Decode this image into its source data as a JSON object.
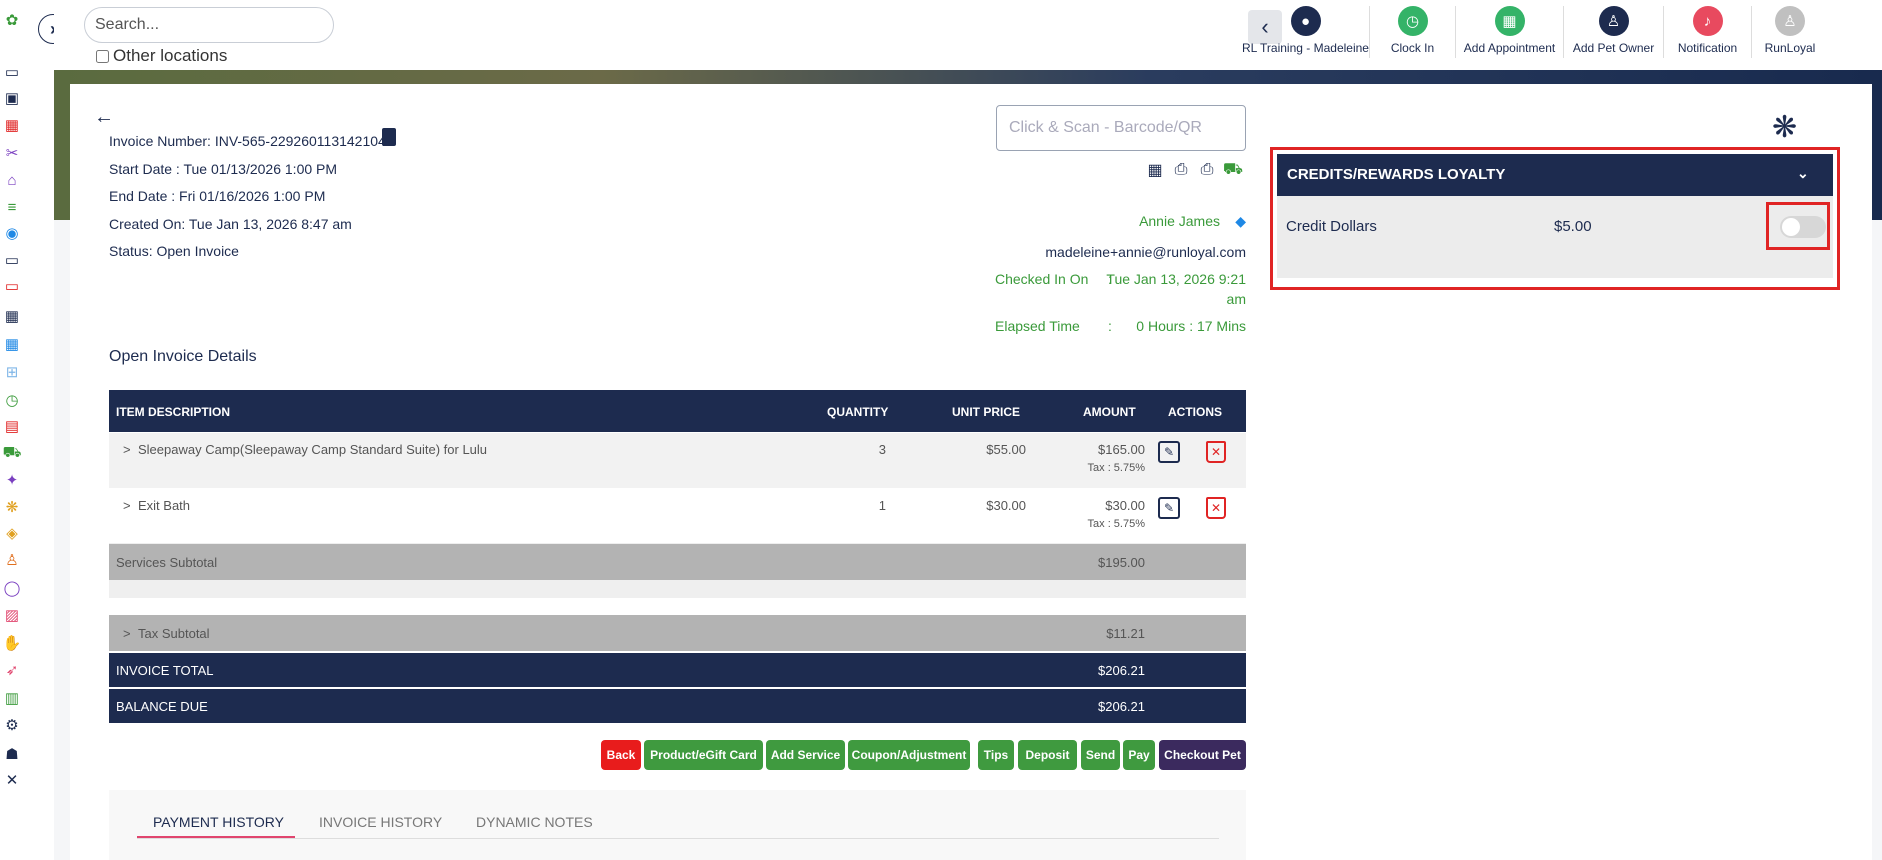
{
  "sidebar": {
    "icons": [
      {
        "name": "runloyal-logo-icon",
        "glyph": "✿",
        "color": "#3a9a3a"
      },
      {
        "name": "today-icon",
        "glyph": "▭",
        "color": "#1d2b4f"
      },
      {
        "name": "dashboard-icon",
        "glyph": "▣",
        "color": "#1d2b4f"
      },
      {
        "name": "calendar-icon",
        "glyph": "▦",
        "color": "#e02424"
      },
      {
        "name": "grooming-icon",
        "glyph": "✂",
        "color": "#7a3fc0"
      },
      {
        "name": "store-icon",
        "glyph": "⌂",
        "color": "#7a3fc0"
      },
      {
        "name": "lodging-icon",
        "glyph": "≡",
        "color": "#3a9a3a"
      },
      {
        "name": "run-card-icon",
        "glyph": "◉",
        "color": "#1e88e5"
      },
      {
        "name": "today-alt-icon",
        "glyph": "▭",
        "color": "#1d2b4f"
      },
      {
        "name": "today-red-icon",
        "glyph": "▭",
        "color": "#e02424"
      },
      {
        "name": "calendar-grid-icon",
        "glyph": "▦",
        "color": "#1d2b4f"
      },
      {
        "name": "schedule-icon",
        "glyph": "▦",
        "color": "#1e88e5"
      },
      {
        "name": "layout-icon",
        "glyph": "⊞",
        "color": "#80b7e8"
      },
      {
        "name": "timer-icon",
        "glyph": "◷",
        "color": "#3a9a3a"
      },
      {
        "name": "report-icon",
        "glyph": "▤",
        "color": "#e02424"
      },
      {
        "name": "cart-icon",
        "glyph": "⛟",
        "color": "#3a9a3a"
      },
      {
        "name": "pet-tag-icon",
        "glyph": "✦",
        "color": "#7a3fc0"
      },
      {
        "name": "paw-icon",
        "glyph": "❋",
        "color": "#e0a020"
      },
      {
        "name": "badge-icon",
        "glyph": "◈",
        "color": "#e0a020"
      },
      {
        "name": "user-icon",
        "glyph": "♙",
        "color": "#e07020"
      },
      {
        "name": "chat-icon",
        "glyph": "◯",
        "color": "#7a3fc0"
      },
      {
        "name": "gallery-icon",
        "glyph": "▨",
        "color": "#e0456e"
      },
      {
        "name": "thumbs-up-icon",
        "glyph": "✋",
        "color": "#7a3fc0"
      },
      {
        "name": "rocket-icon",
        "glyph": "➶",
        "color": "#e0456e"
      },
      {
        "name": "analytics-lock-icon",
        "glyph": "▥",
        "color": "#3a9a3a"
      },
      {
        "name": "settings-lock-icon",
        "glyph": "⚙",
        "color": "#1d2b4f"
      },
      {
        "name": "team-icon",
        "glyph": "☗",
        "color": "#1d2b4f"
      },
      {
        "name": "tools-lock-icon",
        "glyph": "✕",
        "color": "#1d2b4f"
      }
    ]
  },
  "topbar": {
    "search_placeholder": "Search...",
    "other_locations_label": "Other locations",
    "actions": [
      {
        "label": "RL Training - Madeleine",
        "color": "#1d2b4f",
        "glyph": "●"
      },
      {
        "label": "Clock In",
        "color": "#34b368",
        "glyph": "◷"
      },
      {
        "label": "Add Appointment",
        "color": "#34b368",
        "glyph": "▦"
      },
      {
        "label": "Add Pet Owner",
        "color": "#1d2b4f",
        "glyph": "♙"
      },
      {
        "label": "Notification",
        "color": "#e84a5f",
        "glyph": "♪"
      },
      {
        "label": "RunLoyal",
        "color": "#c0c0c0",
        "glyph": "♙"
      }
    ]
  },
  "invoice": {
    "number": "Invoice Number: INV-565-229260113142104",
    "start_date": "Start Date : Tue 01/13/2026 1:00 PM",
    "end_date": "End Date : Fri 01/16/2026 1:00 PM",
    "created_on": "Created On: Tue Jan 13, 2026 8:47 am",
    "status": "Status: Open Invoice",
    "scan_placeholder": "Click & Scan - Barcode/QR",
    "customer_name": "Annie James",
    "customer_email": "madeleine+annie@runloyal.com",
    "checked_in_label": "Checked In On",
    "checked_in_sep": ":",
    "checked_in_value_line1": "Tue Jan 13, 2026 9:21",
    "checked_in_value_line2": "am",
    "elapsed_label": "Elapsed Time",
    "elapsed_sep": ":",
    "elapsed_value": "0 Hours : 17 Mins",
    "details_title": "Open Invoice Details"
  },
  "table": {
    "headers": {
      "description": "ITEM DESCRIPTION",
      "quantity": "QUANTITY",
      "unit_price": "UNIT PRICE",
      "amount": "AMOUNT",
      "actions": "ACTIONS"
    },
    "rows": [
      {
        "expander": ">",
        "description": "Sleepaway Camp(Sleepaway Camp Standard Suite) for Lulu",
        "quantity": "3",
        "unit_price": "$55.00",
        "amount": "$165.00",
        "tax": "Tax : 5.75%"
      },
      {
        "expander": ">",
        "description": "Exit Bath",
        "quantity": "1",
        "unit_price": "$30.00",
        "amount": "$30.00",
        "tax": "Tax : 5.75%"
      }
    ],
    "services_subtotal_label": "Services Subtotal",
    "services_subtotal_value": "$195.00",
    "tax_subtotal_expander": ">",
    "tax_subtotal_label": "Tax Subtotal",
    "tax_subtotal_value": "$11.21",
    "invoice_total_label": "INVOICE TOTAL",
    "invoice_total_value": "$206.21",
    "balance_due_label": "BALANCE DUE",
    "balance_due_value": "$206.21"
  },
  "buttons": [
    {
      "label": "Back",
      "color": "#e81c1c"
    },
    {
      "label": "Product/eGift Card",
      "color": "#3f9a3f"
    },
    {
      "label": "Add Service",
      "color": "#3f9a3f"
    },
    {
      "label": "Coupon/Adjustment",
      "color": "#3f9a3f"
    },
    {
      "label": "Tips",
      "color": "#3f9a3f"
    },
    {
      "label": "Deposit",
      "color": "#3f9a3f"
    },
    {
      "label": "Send",
      "color": "#3f9a3f"
    },
    {
      "label": "Pay",
      "color": "#3f9a3f"
    },
    {
      "label": "Checkout Pet",
      "color": "#3b2a5e"
    }
  ],
  "tabs": [
    "PAYMENT HISTORY",
    "INVOICE HISTORY",
    "DYNAMIC NOTES"
  ],
  "loyalty": {
    "title": "CREDITS/REWARDS LOYALTY",
    "credit_label": "Credit Dollars",
    "credit_value": "$5.00",
    "toggle_on": false
  },
  "colors": {
    "navy": "#1d2b4f",
    "green": "#3a9a3a",
    "highlight_red": "#e02424"
  }
}
